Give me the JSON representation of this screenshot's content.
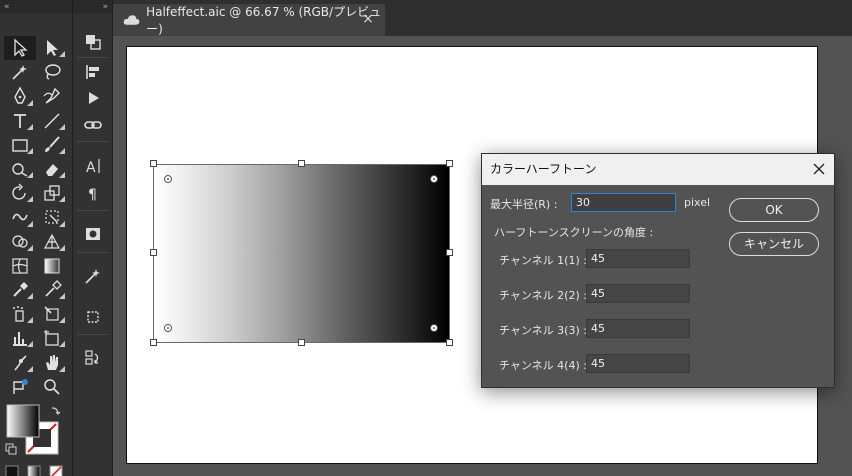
{
  "tools_panel": {
    "collapse_label": "«"
  },
  "panel2": {
    "collapse_label": "»"
  },
  "document_tab": {
    "title": "Halfeffect.aic @ 66.67 % (RGB/プレビュー)",
    "close_glyph": "×"
  },
  "dialog": {
    "title": "カラーハーフトーン",
    "max_radius_label": "最大半径(R) :",
    "max_radius_value": "30",
    "max_radius_unit": "pixel",
    "screen_angles_label": "ハーフトーンスクリーンの角度 :",
    "channels": [
      {
        "label": "チャンネル 1(1) :",
        "value": "45"
      },
      {
        "label": "チャンネル 2(2) :",
        "value": "45"
      },
      {
        "label": "チャンネル 3(3) :",
        "value": "45"
      },
      {
        "label": "チャンネル 4(4) :",
        "value": "45"
      }
    ],
    "ok_label": "OK",
    "cancel_label": "キャンセル"
  },
  "colors": {
    "accent_focus": "#2f86d6",
    "panel_bg": "#323232",
    "workspace_bg": "#535353"
  }
}
